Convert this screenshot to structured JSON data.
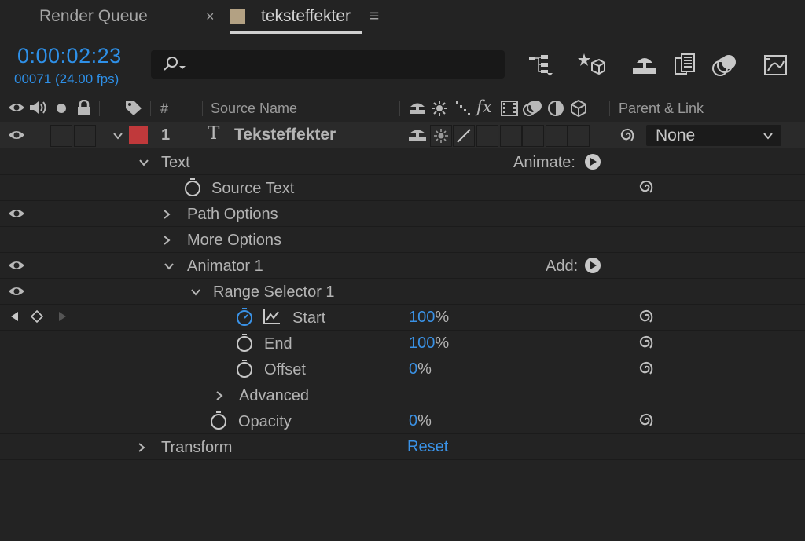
{
  "tabs": {
    "render_queue": "Render Queue",
    "close_glyph": "×",
    "active": "teksteffekter",
    "menu_glyph": "≡"
  },
  "time": {
    "timecode": "0:00:02:23",
    "frame_info": "00071 (24.00 fps)"
  },
  "search": {
    "placeholder": ""
  },
  "header": {
    "hash": "#",
    "source_name": "Source Name",
    "fx": "fx",
    "parent_link": "Parent & Link"
  },
  "layer": {
    "number": "1",
    "type_glyph": "T",
    "name": "Teksteffekter",
    "label_color": "#c0393b",
    "parent_value": "None"
  },
  "rows": {
    "text": "Text",
    "animate": "Animate:",
    "source_text": "Source Text",
    "path_options": "Path Options",
    "more_options": "More Options",
    "animator": "Animator 1",
    "add": "Add:",
    "range_selector": "Range Selector 1",
    "start": "Start",
    "start_num": "100",
    "start_unit": "%",
    "end": "End",
    "end_num": "100",
    "end_unit": "%",
    "offset": "Offset",
    "offset_num": "0",
    "offset_unit": "%",
    "advanced": "Advanced",
    "opacity": "Opacity",
    "opacity_num": "0",
    "opacity_unit": "%",
    "transform": "Transform",
    "reset": "Reset"
  },
  "colors": {
    "accent_blue": "#2e90e8",
    "background": "#232323",
    "tab_swatch": "#b3a183"
  }
}
